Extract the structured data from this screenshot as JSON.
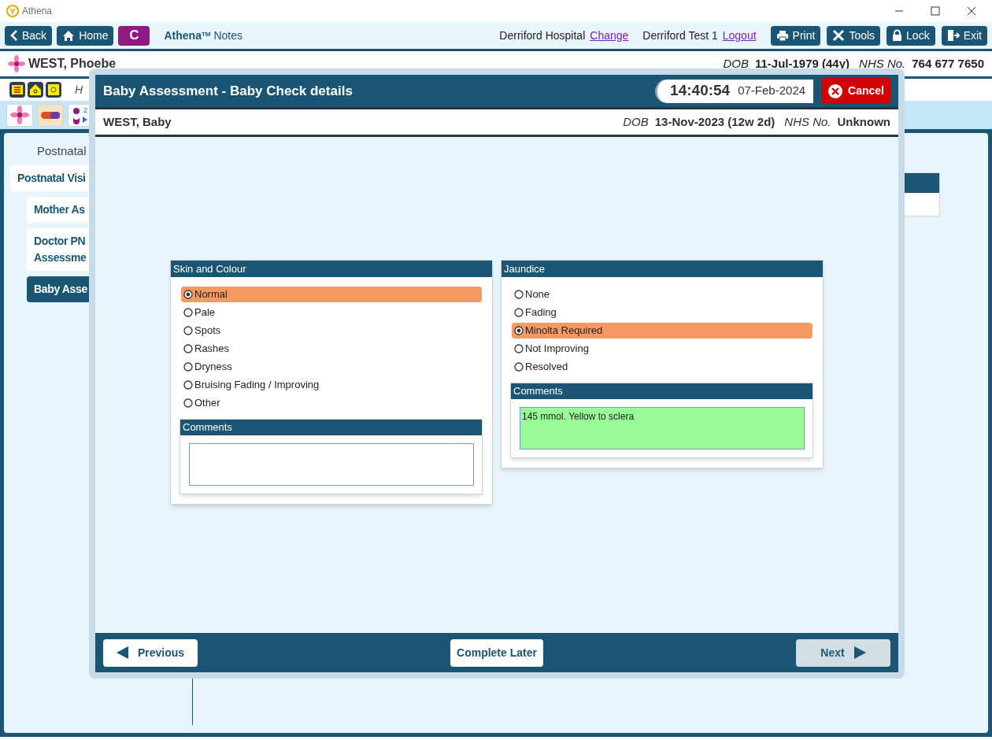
{
  "window": {
    "title": "Athena"
  },
  "toolbar": {
    "left_buttons": [
      {
        "label": "Back"
      },
      {
        "label": "Home"
      }
    ],
    "badge": "C",
    "brand": "Athena",
    "trademark": "TM",
    "product": "Notes",
    "location": "Derriford Hospital",
    "change_link": "Change",
    "user": "Derriford Test 1",
    "logout_link": "Logout",
    "right_buttons": [
      {
        "label": "Print"
      },
      {
        "label": "Tools"
      },
      {
        "label": "Lock"
      },
      {
        "label": "Exit"
      }
    ]
  },
  "patient": {
    "name": "WEST, Phoebe",
    "dob_label": "DOB",
    "dob": "11-Jul-1979 (44y)",
    "nhs_label": "NHS No.",
    "nhs": "764 677 7650"
  },
  "alert_row": {
    "text": "H"
  },
  "quick_buttons": {
    "baby_count": "2"
  },
  "sidebar": {
    "heading": "Postnatal",
    "items": [
      {
        "label": "Postnatal Visi",
        "selected": false,
        "children": [
          {
            "label": "Mother As",
            "selected": false
          },
          {
            "label": "Doctor PN\nAssessme",
            "selected": false
          },
          {
            "label": "Baby Asse",
            "selected": true
          }
        ]
      }
    ]
  },
  "modal": {
    "title": "Baby Assessment - Baby Check details",
    "time": "14:40:54",
    "date": "07-Feb-2024",
    "cancel": "Cancel",
    "baby": {
      "name": "WEST, Baby",
      "dob_label": "DOB",
      "dob": "13-Nov-2023 (12w 2d)",
      "nhs_label": "NHS No.",
      "nhs": "Unknown"
    },
    "sections": [
      {
        "title": "Skin and Colour",
        "options": [
          {
            "label": "Normal",
            "selected": true
          },
          {
            "label": "Pale",
            "selected": false
          },
          {
            "label": "Spots",
            "selected": false
          },
          {
            "label": "Rashes",
            "selected": false
          },
          {
            "label": "Dryness",
            "selected": false
          },
          {
            "label": "Bruising Fading / Improving",
            "selected": false
          },
          {
            "label": "Other",
            "selected": false
          }
        ],
        "comments": {
          "title": "Comments",
          "filled": false
        }
      },
      {
        "title": "Jaundice",
        "options": [
          {
            "label": "None",
            "selected": false
          },
          {
            "label": "Fading",
            "selected": false
          },
          {
            "label": "Minolta Required",
            "selected": true
          },
          {
            "label": "Not Improving",
            "selected": false
          },
          {
            "label": "Resolved",
            "selected": false
          }
        ],
        "comments": {
          "title": "Comments",
          "value": "145 mmol. Yellow to sclera",
          "filled": true
        }
      }
    ],
    "footer": {
      "previous": {
        "label": "Previous",
        "disabled": false
      },
      "complete_later": {
        "label": "Complete Later",
        "disabled": false
      },
      "next": {
        "label": "Next",
        "disabled": true
      }
    }
  }
}
